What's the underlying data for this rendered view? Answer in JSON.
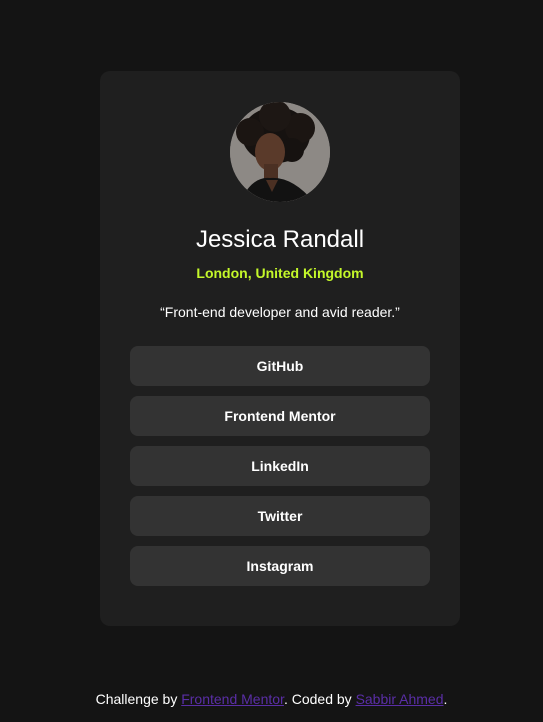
{
  "profile": {
    "name": "Jessica Randall",
    "location": "London, United Kingdom",
    "bio": "“Front-end developer and avid reader.”"
  },
  "links": [
    {
      "label": "GitHub"
    },
    {
      "label": "Frontend Mentor"
    },
    {
      "label": "LinkedIn"
    },
    {
      "label": "Twitter"
    },
    {
      "label": "Instagram"
    }
  ],
  "footer": {
    "prefix": "Challenge by ",
    "challenge_link": "Frontend Mentor",
    "middle": ". Coded by ",
    "author_link": "Sabbir Ahmed",
    "suffix": "."
  },
  "colors": {
    "background": "#141414",
    "card": "#1f1f1f",
    "button": "#333333",
    "accent": "#c4f82a",
    "link": "#5a2ea6"
  }
}
